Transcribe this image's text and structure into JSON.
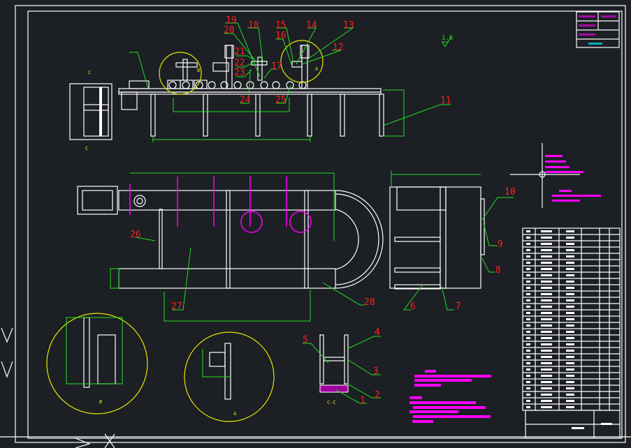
{
  "drawing": {
    "surface_finish": "1.6",
    "view_labels": {
      "section_top": "C",
      "section_bottom": "C",
      "detail_b": "B",
      "detail_a": "A",
      "detail_b_caption": "B",
      "detail_a_caption": "A",
      "section_caption": "C-C"
    },
    "part_numbers": [
      "1",
      "2",
      "3",
      "4",
      "5",
      "6",
      "7",
      "8",
      "9",
      "10",
      "11",
      "12",
      "13",
      "14",
      "15",
      "16",
      "17",
      "18",
      "19",
      "20",
      "21",
      "22",
      "23",
      "24",
      "25",
      "26",
      "27",
      "28"
    ]
  },
  "colors": {
    "background": "#1c1f24",
    "geometry": "#ffffff",
    "leaders": "#22e022",
    "numbers": "#ff2020",
    "hatch": "#ff00ff",
    "detail_circles": "#e8e800"
  }
}
